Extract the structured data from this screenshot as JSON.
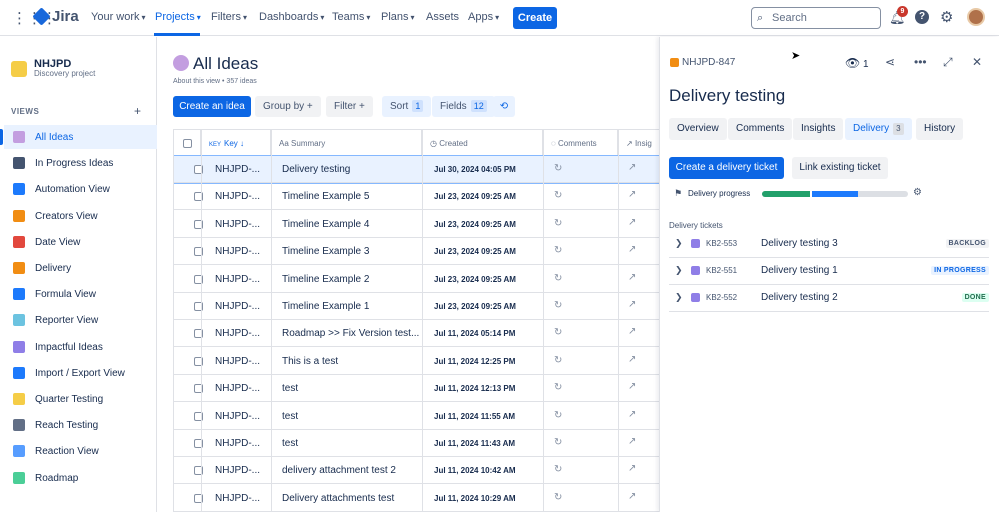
{
  "topnav": {
    "brand": "Jira",
    "items": [
      {
        "label": "Your work",
        "active": false
      },
      {
        "label": "Projects",
        "active": true
      },
      {
        "label": "Filters",
        "active": false
      },
      {
        "label": "Dashboards",
        "active": false
      },
      {
        "label": "Teams",
        "active": false
      },
      {
        "label": "Plans",
        "active": false
      },
      {
        "label": "Assets",
        "active": false
      },
      {
        "label": "Apps",
        "active": false
      }
    ],
    "create_label": "Create",
    "search_placeholder": "Search",
    "notification_count": "9"
  },
  "sidebar": {
    "project_name": "NHJPD",
    "project_type": "Discovery project",
    "views_label": "VIEWS",
    "items": [
      {
        "label": "All Ideas",
        "icon": "bulb-icon",
        "color": "#c39ee0",
        "selected": true
      },
      {
        "label": "In Progress Ideas",
        "icon": "soon-icon",
        "color": "#44546f"
      },
      {
        "label": "Automation View",
        "icon": "infinity-icon",
        "color": "#1d7afc"
      },
      {
        "label": "Creators View",
        "icon": "person-icon",
        "color": "#f18d13"
      },
      {
        "label": "Date View",
        "icon": "calendar-icon",
        "color": "#e2483d"
      },
      {
        "label": "Delivery",
        "icon": "truck-icon",
        "color": "#f18d13"
      },
      {
        "label": "Formula View",
        "icon": "abacus-icon",
        "color": "#1d7afc"
      },
      {
        "label": "Reporter View",
        "icon": "pen-icon",
        "color": "#6cc3e0"
      },
      {
        "label": "Impactful Ideas",
        "icon": "chart-icon",
        "color": "#8f7ee7"
      },
      {
        "label": "Import / Export View",
        "icon": "arrows-icon",
        "color": "#1d7afc"
      },
      {
        "label": "Quarter Testing",
        "icon": "runner-icon",
        "color": "#f5cd47"
      },
      {
        "label": "Reach Testing",
        "icon": "satellite-icon",
        "color": "#626f86"
      },
      {
        "label": "Reaction View",
        "icon": "bus-icon",
        "color": "#579dff"
      },
      {
        "label": "Roadmap",
        "icon": "map-icon",
        "color": "#4bce97"
      }
    ]
  },
  "main": {
    "title": "All Ideas",
    "subtitle": "About this view • 357 ideas",
    "create_idea": "Create an idea",
    "group_by": "Group by",
    "filter": "Filter",
    "sort": "Sort",
    "sort_count": "1",
    "fields": "Fields",
    "fields_count": "12",
    "columns": {
      "key": "Key",
      "key_prefix": "KEY",
      "summary": "Summary",
      "created": "Created",
      "comments": "Comments",
      "insights": "Insig"
    },
    "rows": [
      {
        "key": "NHJPD-...",
        "summary": "Delivery testing",
        "created": "Jul 30, 2024 04:05 PM",
        "selected": true
      },
      {
        "key": "NHJPD-...",
        "summary": "Timeline Example 5",
        "created": "Jul 23, 2024 09:25 AM"
      },
      {
        "key": "NHJPD-...",
        "summary": "Timeline Example 4",
        "created": "Jul 23, 2024 09:25 AM"
      },
      {
        "key": "NHJPD-...",
        "summary": "Timeline Example 3",
        "created": "Jul 23, 2024 09:25 AM"
      },
      {
        "key": "NHJPD-...",
        "summary": "Timeline Example 2",
        "created": "Jul 23, 2024 09:25 AM"
      },
      {
        "key": "NHJPD-...",
        "summary": "Timeline Example 1",
        "created": "Jul 23, 2024 09:25 AM"
      },
      {
        "key": "NHJPD-...",
        "summary": "Roadmap >> Fix Version test...",
        "created": "Jul 11, 2024 05:14 PM"
      },
      {
        "key": "NHJPD-...",
        "summary": "This is a test",
        "created": "Jul 11, 2024 12:25 PM"
      },
      {
        "key": "NHJPD-...",
        "summary": "test",
        "created": "Jul 11, 2024 12:13 PM"
      },
      {
        "key": "NHJPD-...",
        "summary": "test",
        "created": "Jul 11, 2024 11:55 AM"
      },
      {
        "key": "NHJPD-...",
        "summary": "test",
        "created": "Jul 11, 2024 11:43 AM"
      },
      {
        "key": "NHJPD-...",
        "summary": "delivery attachment test 2",
        "created": "Jul 11, 2024 10:42 AM"
      },
      {
        "key": "NHJPD-...",
        "summary": "Delivery attachments test",
        "created": "Jul 11, 2024 10:29 AM"
      }
    ]
  },
  "panel": {
    "issue_key": "NHJPD-847",
    "watch_count": "1",
    "title": "Delivery testing",
    "tabs": [
      {
        "label": "Overview"
      },
      {
        "label": "Comments"
      },
      {
        "label": "Insights"
      },
      {
        "label": "Delivery",
        "count": "3",
        "selected": true
      },
      {
        "label": "History"
      }
    ],
    "create_ticket": "Create a delivery ticket",
    "link_ticket": "Link existing ticket",
    "progress_label": "Delivery progress",
    "progress_done": 0.33,
    "progress_in_progress": 0.33,
    "tickets_label": "Delivery tickets",
    "tickets": [
      {
        "key": "KB2-553",
        "summary": "Delivery testing 3",
        "status": "BACKLOG",
        "status_color": "#44546f",
        "status_bg": "#f1f2f4"
      },
      {
        "key": "KB2-551",
        "summary": "Delivery testing 1",
        "status": "IN PROGRESS",
        "status_color": "#0c66e4",
        "status_bg": "#e9f2ff"
      },
      {
        "key": "KB2-552",
        "summary": "Delivery testing 2",
        "status": "DONE",
        "status_color": "#216e4e",
        "status_bg": "#dcfff1"
      }
    ]
  }
}
